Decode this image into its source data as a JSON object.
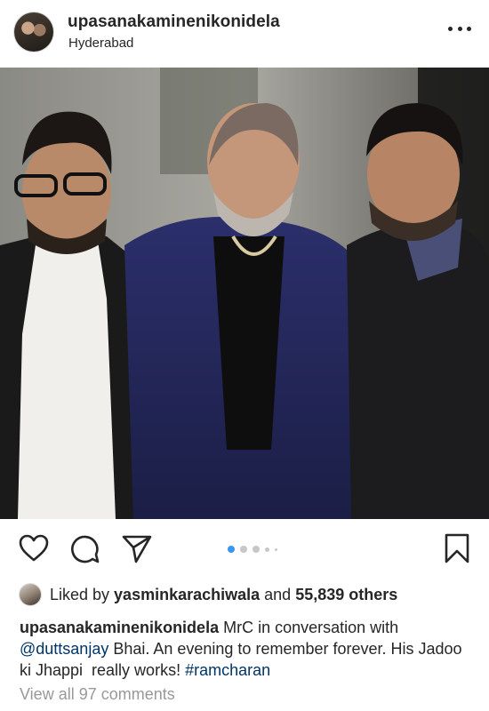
{
  "post": {
    "username": "upasanakaminenikonidela",
    "location": "Hyderabad"
  },
  "icons": {
    "more": "more-options-icon",
    "like": "heart-icon",
    "comment": "comment-icon",
    "share": "send-icon",
    "save": "bookmark-icon"
  },
  "carousel": {
    "total_dots": 5,
    "active_index": 0
  },
  "likes": {
    "prefix": "Liked by ",
    "user": "yasminkarachiwala",
    "middle": " and ",
    "count": "55,839 others"
  },
  "caption": {
    "username": "upasanakaminenikonidela",
    "text_1": " MrC in conversation with ",
    "mention": "@duttsanjay",
    "text_2": " Bhai. An evening to remember forever. His Jadoo ki Jhappi  really works! ",
    "hashtag": "#ramcharan"
  },
  "comments": {
    "label": "View all 97 comments"
  },
  "colors": {
    "link": "#003569",
    "active_dot": "#3897f0",
    "muted": "#999999"
  }
}
